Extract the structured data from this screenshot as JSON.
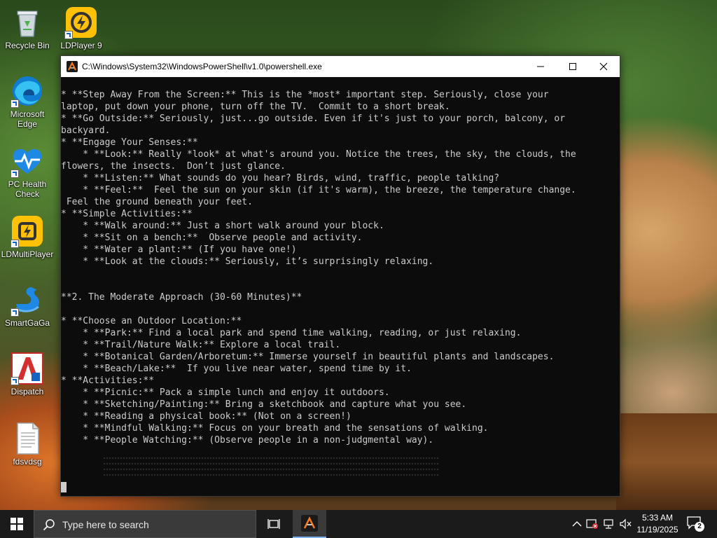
{
  "desktop": {
    "icons": [
      {
        "label": "Recycle Bin"
      },
      {
        "label": "LDPlayer 9"
      },
      {
        "label": "Microsoft Edge"
      },
      {
        "label": "PC Health Check"
      },
      {
        "label": "LDMultiPlayer"
      },
      {
        "label": "SmartGaGa"
      },
      {
        "label": "Dispatch"
      },
      {
        "label": "fdsvdsg"
      }
    ]
  },
  "terminal": {
    "title": "C:\\Windows\\System32\\WindowsPowerShell\\v1.0\\powershell.exe",
    "text": "* **Step Away From the Screen:** This is the *most* important step. Seriously, close your\nlaptop, put down your phone, turn off the TV.  Commit to a short break.\n* **Go Outside:** Seriously, just...go outside. Even if it's just to your porch, balcony, or\nbackyard.\n* **Engage Your Senses:**\n    * **Look:** Really *look* at what's around you. Notice the trees, the sky, the clouds, the\nflowers, the insects.  Don’t just glance.\n    * **Listen:** What sounds do you hear? Birds, wind, traffic, people talking?\n    * **Feel:**  Feel the sun on your skin (if it's warm), the breeze, the temperature change.\n Feel the ground beneath your feet.\n* **Simple Activities:**\n    * **Walk around:** Just a short walk around your block.\n    * **Sit on a bench:**  Observe people and activity.\n    * **Water a plant:** (If you have one!)\n    * **Look at the clouds:** Seriously, it’s surprisingly relaxing.\n\n\n**2. The Moderate Approach (30-60 Minutes)**\n\n* **Choose an Outdoor Location:**\n    * **Park:** Find a local park and spend time walking, reading, or just relaxing.\n    * **Trail/Nature Walk:** Explore a local trail.\n    * **Botanical Garden/Arboretum:** Immerse yourself in beautiful plants and landscapes.\n    * **Beach/Lake:**  If you live near water, spend time by it.\n* **Activities:**\n    * **Picnic:** Pack a simple lunch and enjoy it outdoors.\n    * **Sketching/Painting:** Bring a sketchbook and capture what you see.\n    * **Reading a physical book:** (Not on a screen!)\n    * **Mindful Walking:** Focus on your breath and the sensations of walking.\n    * **People Watching:** (Observe people in a non-judgmental way)."
  },
  "taskbar": {
    "search_placeholder": "Type here to search",
    "clock_time": "5:33 AM",
    "clock_date": "11/19/2025",
    "notification_count": "2"
  },
  "colors": {
    "terminal_bg": "#0c0c0c",
    "terminal_fg": "#cccccc",
    "taskbar_bg": "#1b1b1b",
    "accent": "#7fb3f0"
  }
}
